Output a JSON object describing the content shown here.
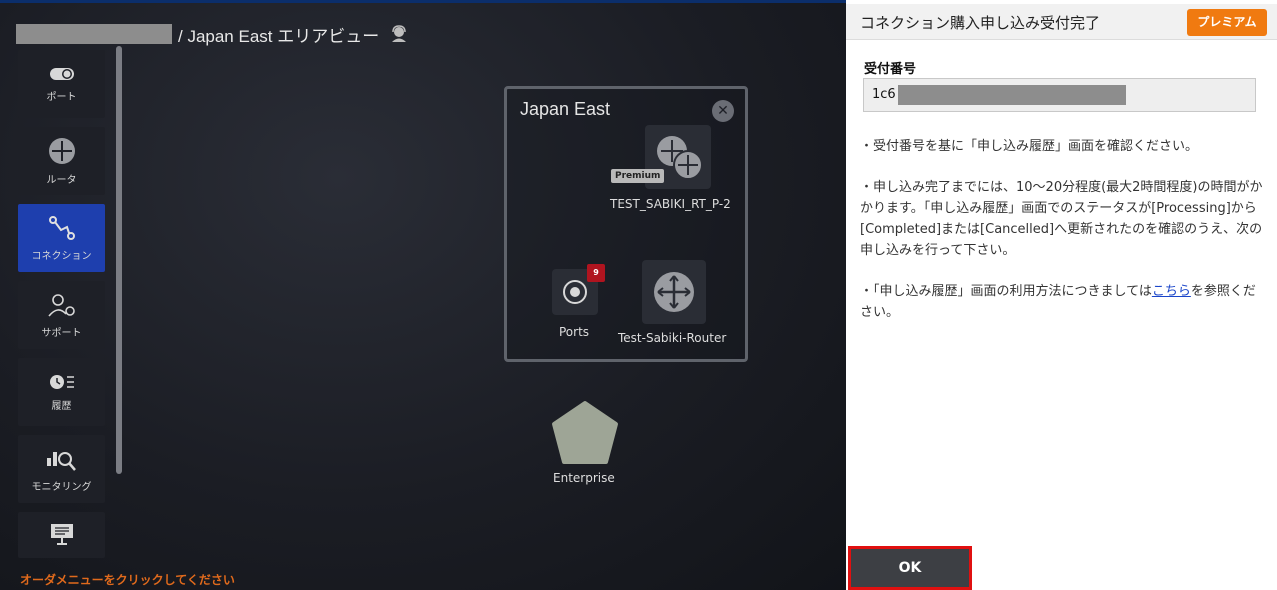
{
  "breadcrumb": {
    "text": "/ Japan East エリアビュー"
  },
  "sidebar": {
    "items": [
      {
        "label": "ポート",
        "icon": "port-toggle-icon",
        "active": false
      },
      {
        "label": "ルータ",
        "icon": "router-icon",
        "active": false
      },
      {
        "label": "コネクション",
        "icon": "connection-icon",
        "active": true
      },
      {
        "label": "サポート",
        "icon": "support-user-gear-icon",
        "active": false
      },
      {
        "label": "履歴",
        "icon": "history-icon",
        "active": false
      },
      {
        "label": "モニタリング",
        "icon": "monitoring-icon",
        "active": false
      },
      {
        "label": "",
        "icon": "monitor-screen-icon",
        "active": false
      }
    ],
    "order_hint": "オーダメニューをクリックしてください"
  },
  "area": {
    "title": "Japan East",
    "nodes": {
      "premium_router": {
        "tag": "Premium",
        "label": "TEST_SABIKI_RT_P-2"
      },
      "ports": {
        "label": "Ports",
        "badge": "9"
      },
      "router": {
        "label": "Test-Sabiki-Router"
      },
      "enterprise": {
        "label": "Enterprise"
      }
    }
  },
  "dialog": {
    "title": "コネクション購入申し込み受付完了",
    "premium_label": "プレミアム",
    "receipt_label": "受付番号",
    "receipt_value": "1c6",
    "note1": "・受付番号を基に「申し込み履歴」画面を確認ください。",
    "note2": "・申し込み完了までには、10～20分程度(最大2時間程度)の時間がかかります。「申し込み履歴」画面でのステータスが[Processing]から[Completed]または[Cancelled]へ更新されたのを確認のうえ、次の申し込みを行って下さい。",
    "note3_prefix": "・「申し込み履歴」画面の利用方法につきましては",
    "note3_link": "こちら",
    "note3_suffix": "を参照ください。",
    "ok_label": "OK"
  },
  "colors": {
    "accent_orange": "#f07a10",
    "active_blue": "#1e3fae",
    "highlight_red": "#e01010",
    "badge_red": "#b0141f"
  }
}
